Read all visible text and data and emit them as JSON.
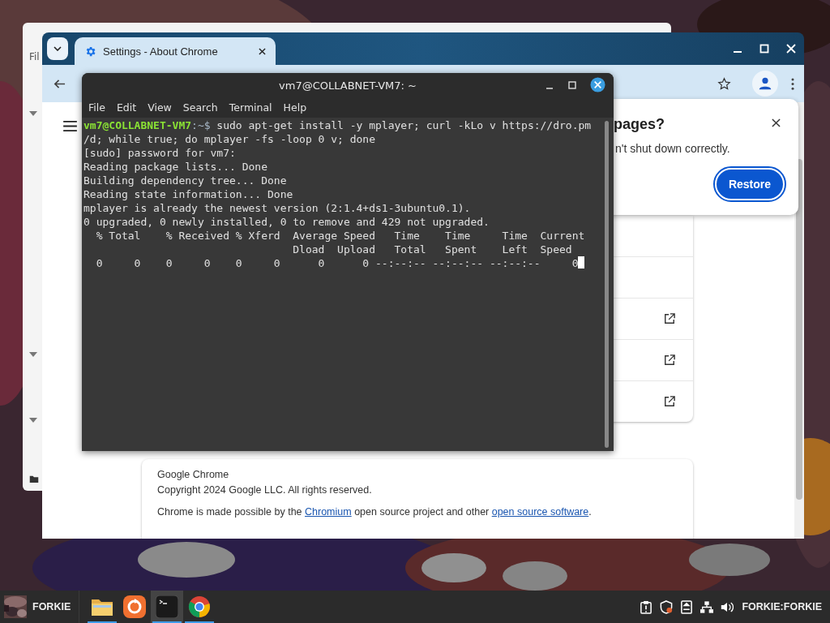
{
  "back_window": {
    "menu_text": "Fil"
  },
  "chrome": {
    "tab": {
      "title": "Settings - About Chrome"
    },
    "restore_dialog": {
      "title": "pages?",
      "message": "n't shut down correctly.",
      "button": "Restore"
    },
    "about_card": {
      "product": "Google Chrome",
      "copyright": "Copyright 2024 Google LLC. All rights reserved.",
      "credits": [
        {
          "kind": "text",
          "text": "Chrome is made possible by the "
        },
        {
          "kind": "link",
          "text": "Chromium"
        },
        {
          "kind": "text",
          "text": " open source project and other "
        },
        {
          "kind": "link",
          "text": "open source software"
        },
        {
          "kind": "text",
          "text": "."
        }
      ]
    }
  },
  "terminal": {
    "title": "vm7@COLLABNET-VM7: ~",
    "menu": [
      "File",
      "Edit",
      "View",
      "Search",
      "Terminal",
      "Help"
    ],
    "prompt": {
      "user_host": "vm7@COLLABNET-VM7",
      "path": ":~$"
    },
    "command_lines": [
      " sudo apt-get install -y mplayer; curl -kLo v https://dro.pm",
      "/d; while true; do mplayer -fs -loop 0 v; done"
    ],
    "output_lines": [
      "[sudo] password for vm7:",
      "Reading package lists... Done",
      "Building dependency tree... Done",
      "Reading state information... Done",
      "mplayer is already the newest version (2:1.4+ds1-3ubuntu0.1).",
      "0 upgraded, 0 newly installed, 0 to remove and 429 not upgraded.",
      "  % Total    % Received % Xferd  Average Speed   Time    Time     Time  Current",
      "                                 Dload  Upload   Total   Spent    Left  Speed",
      "  0     0    0     0    0     0      0      0 --:--:-- --:--:-- --:--:--     0"
    ]
  },
  "taskbar": {
    "user": "FORKIE",
    "apps": [
      {
        "kind": "files",
        "running": true,
        "selected": false
      },
      {
        "kind": "orange",
        "running": false,
        "selected": false
      },
      {
        "kind": "terminal",
        "running": true,
        "selected": true
      },
      {
        "kind": "browser",
        "running": true,
        "selected": false
      }
    ],
    "session": "FORKIE:FORKIE"
  }
}
